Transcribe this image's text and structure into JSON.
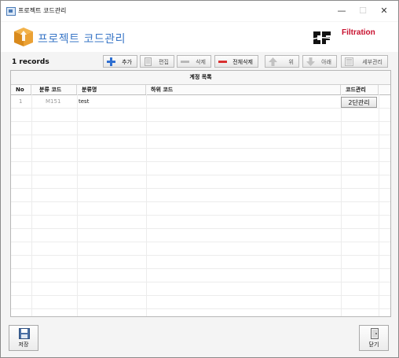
{
  "window": {
    "title": "프로젝트 코드관리",
    "controls": {
      "minimize": "—",
      "maximize": "☐",
      "close": "✕"
    }
  },
  "header": {
    "title": "프로젝트 코드관리",
    "brand_text": "Filtration",
    "icon": "package-icon",
    "brand_logo_icon": "brand-logo-icon"
  },
  "toolbar": {
    "records": "1 records",
    "buttons": [
      {
        "label": "추가",
        "icon": "plus-icon",
        "enabled": true
      },
      {
        "label": "편집",
        "icon": "document-icon",
        "enabled": false
      },
      {
        "label": "삭제",
        "icon": "minus-icon",
        "enabled": false
      },
      {
        "label": "전체삭제",
        "icon": "minus-red-icon",
        "enabled": true
      },
      {
        "label": "위",
        "icon": "arrow-up-icon",
        "enabled": false
      },
      {
        "label": "아래",
        "icon": "arrow-down-icon",
        "enabled": false
      },
      {
        "label": "세부관리",
        "icon": "details-icon",
        "enabled": false
      }
    ]
  },
  "grid": {
    "title": "계정 목록",
    "columns": [
      "No",
      "분류 코드",
      "분류명",
      "하위 코드",
      "코드관리"
    ],
    "rows": [
      {
        "no": "1",
        "code": "M151",
        "name": "test",
        "sub_code": "",
        "action_label": "2단관리"
      }
    ]
  },
  "footer": {
    "save_label": "저장",
    "close_label": "닫기"
  },
  "colors": {
    "title_blue": "#3a77c7",
    "brand_red": "#c8102e",
    "plus_blue": "#2f6fd1",
    "minus_red": "#d93030"
  }
}
